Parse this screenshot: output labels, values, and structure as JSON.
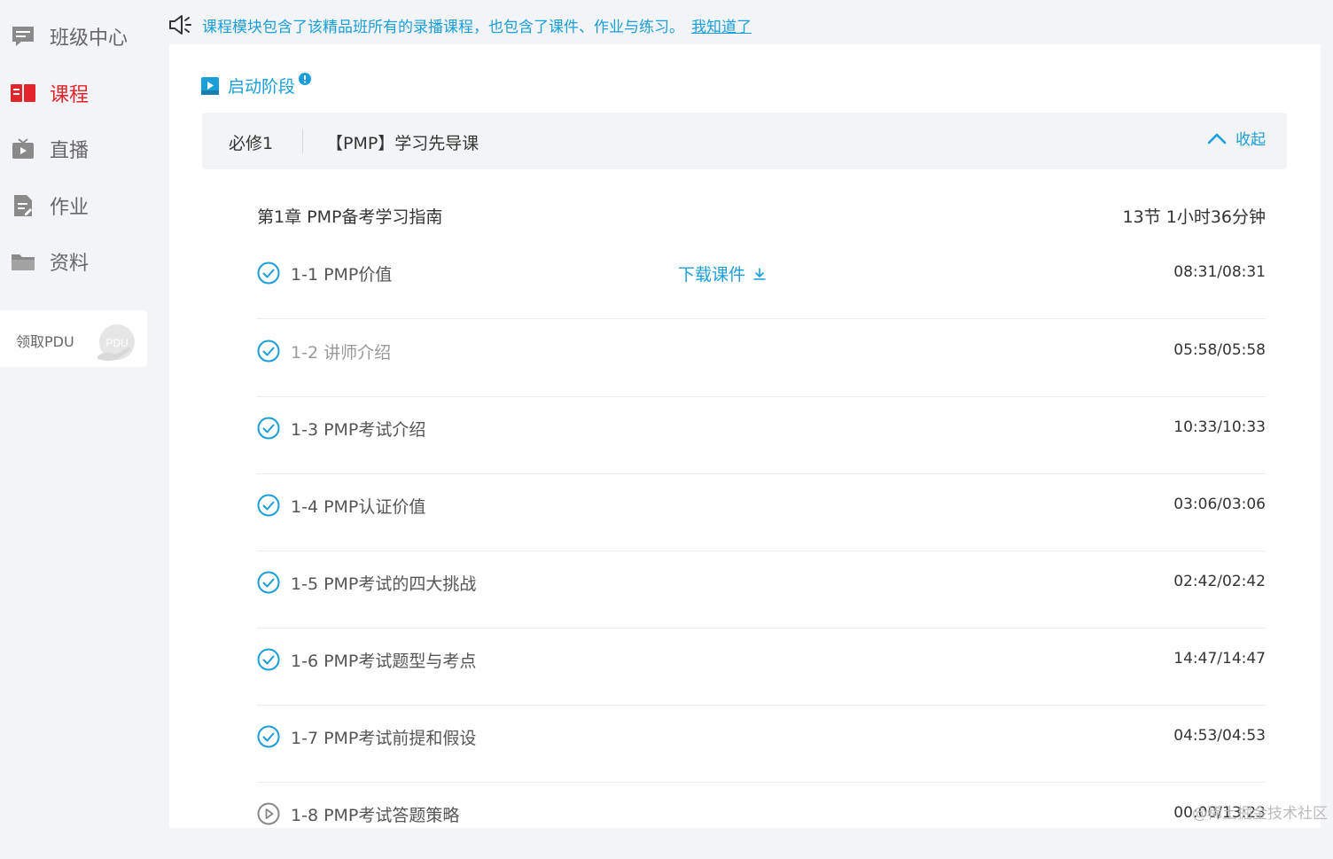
{
  "sidebar": {
    "items": [
      {
        "label": "班级中心",
        "icon": "chat-board-icon"
      },
      {
        "label": "课程",
        "icon": "open-book-icon"
      },
      {
        "label": "直播",
        "icon": "tv-play-icon"
      },
      {
        "label": "作业",
        "icon": "document-edit-icon"
      },
      {
        "label": "资料",
        "icon": "folder-icon"
      }
    ],
    "pdu": {
      "label": "领取PDU",
      "badge": "PDU"
    }
  },
  "notice": {
    "text": "课程模块包含了该精品班所有的录播课程，也包含了课件、作业与练习。",
    "ack": "我知道了"
  },
  "stage": {
    "title": "启动阶段"
  },
  "course": {
    "tag": "必修1",
    "title": "【PMP】学习先导课",
    "collapse": "收起"
  },
  "chapter": {
    "title": "第1章 PMP备考学习指南",
    "meta": "13节 1小时36分钟"
  },
  "lesson_download_label": "下载课件",
  "lessons": [
    {
      "title": "1-1 PMP价值",
      "time": "08:31/08:31"
    },
    {
      "title": "1-2 讲师介绍",
      "time": "05:58/05:58"
    },
    {
      "title": "1-3 PMP考试介绍",
      "time": "10:33/10:33"
    },
    {
      "title": "1-4 PMP认证价值",
      "time": "03:06/03:06"
    },
    {
      "title": "1-5 PMP考试的四大挑战",
      "time": "02:42/02:42"
    },
    {
      "title": "1-6 PMP考试题型与考点",
      "time": "14:47/14:47"
    },
    {
      "title": "1-7 PMP考试前提和假设",
      "time": "04:53/04:53"
    },
    {
      "title": "1-8 PMP考试答题策略",
      "time": "00:00/13:23"
    }
  ],
  "watermark": "@稀土掘金技术社区",
  "colors": {
    "accent": "#1a9ed8",
    "active": "#e0252b",
    "panel": "#ffffff",
    "page": "#f2f4f8"
  }
}
